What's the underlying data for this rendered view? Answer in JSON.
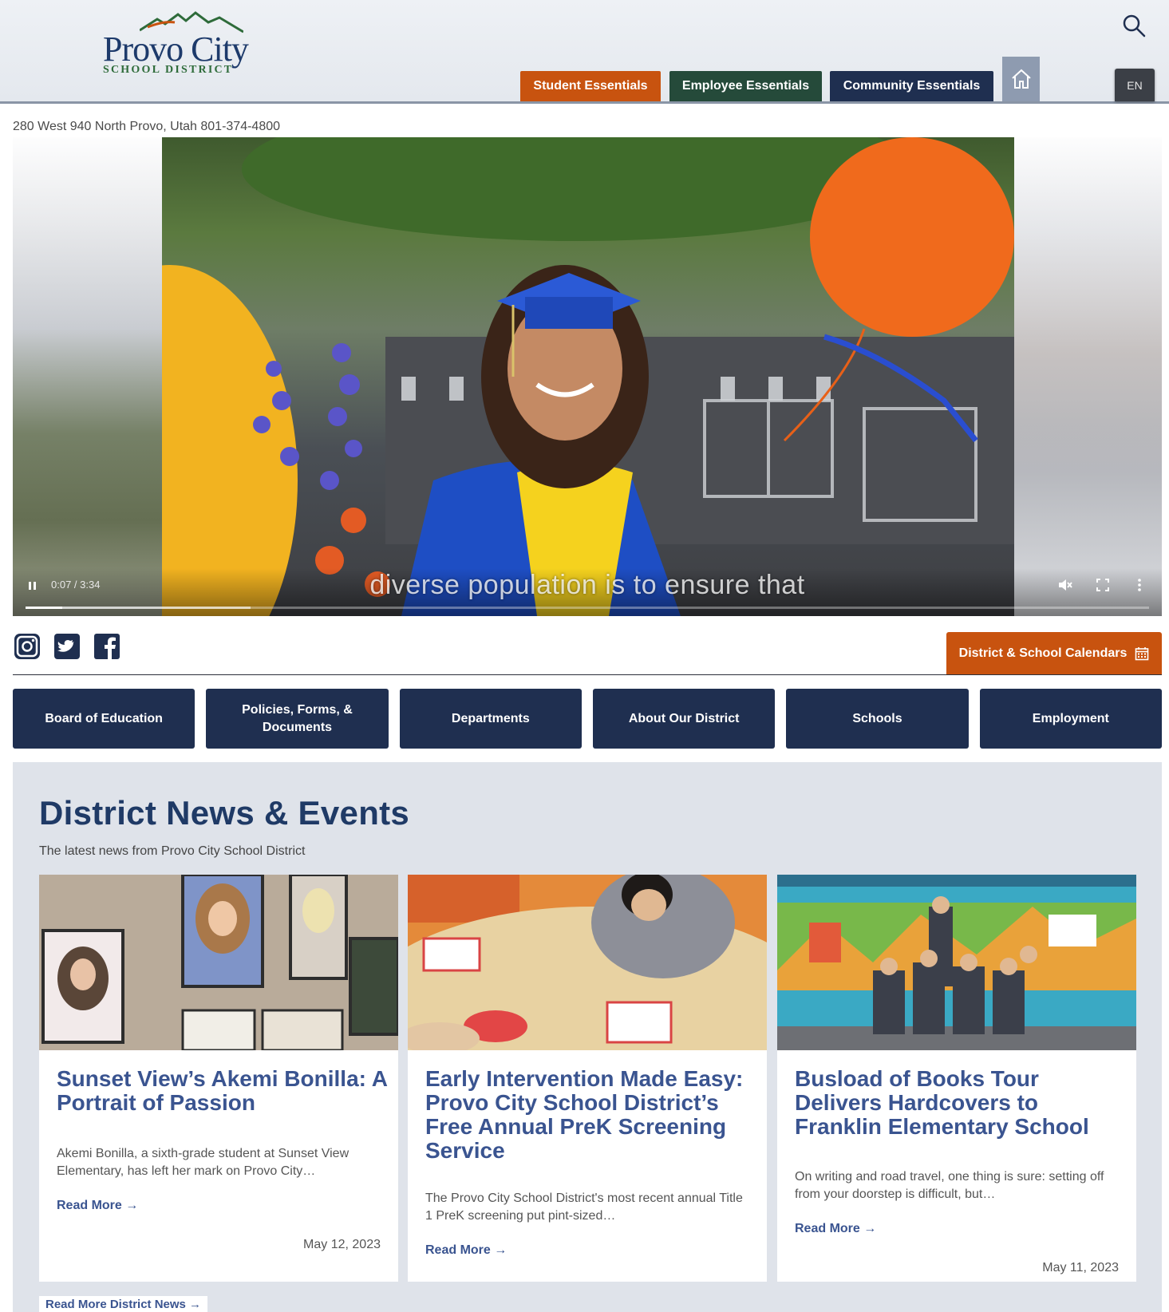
{
  "header": {
    "logo_main": "Provo City",
    "logo_sub": "SCHOOL DISTRICT",
    "search_icon": "search-icon",
    "essentials": [
      {
        "label": "Student Essentials",
        "color": "#c8530f"
      },
      {
        "label": "Employee Essentials",
        "color": "#254a3a"
      },
      {
        "label": "Community Essentials",
        "color": "#1f2f50"
      }
    ],
    "home_icon": "home-icon",
    "language": "EN"
  },
  "address": "280 West 940 North Provo, Utah 801-374-4800",
  "video": {
    "time": "0:07 / 3:34",
    "caption": "diverse population is to ensure that",
    "progress": 0.033,
    "state": "playing",
    "muted": true
  },
  "social": [
    "instagram-icon",
    "twitter-icon",
    "facebook-icon"
  ],
  "calendar_button": "District & School Calendars",
  "nav": [
    "Board of Education",
    "Policies, Forms, & Documents",
    "Departments",
    "About Our District",
    "Schools",
    "Employment"
  ],
  "news": {
    "title": "District News & Events",
    "subtitle": "The latest news from Provo City School District",
    "cards": [
      {
        "title": "Sunset View’s Akemi Bonilla: A Portrait of Passion",
        "desc": "Akemi Bonilla, a sixth-grade student at Sunset View Elementary, has left her mark on Provo City…",
        "more": "Read More →",
        "date": "May 12, 2023"
      },
      {
        "title": "Early Intervention Made Easy: Provo City School District’s Free Annual PreK Screening Service",
        "desc": "The Provo City School District's most recent annual Title 1 PreK screening put pint-sized…",
        "more": "Read More →",
        "date": ""
      },
      {
        "title": "Busload of Books Tour Delivers Hardcovers to Franklin Elementary School",
        "desc": "On writing and road travel, one thing is sure: setting off from your doorstep is difficult, but…",
        "more": "Read More →",
        "date": "May 11, 2023"
      }
    ],
    "more_link": "Read More District News →"
  },
  "colors": {
    "navy": "#1f2f50",
    "orange": "#c8530f",
    "green": "#254a3a",
    "link_blue": "#3a5490",
    "news_bg": "#dfe3ea"
  }
}
